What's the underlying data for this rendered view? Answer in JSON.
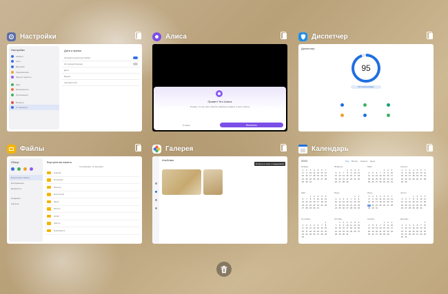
{
  "apps": {
    "settings": {
      "title": "Настройки",
      "header": "Настройки",
      "items": [
        "Аккаунт",
        "Сеть",
        "Bluetooth",
        "Уведомления",
        "Экран и яркость",
        "Звук",
        "Безопасность",
        "Приложения",
        "Батарея",
        "О планшете"
      ],
      "main_title": "Дата и время",
      "main_rows": [
        "Автоматическая настройка",
        "24-часовой формат",
        "Дата",
        "Время",
        "Часовой пояс"
      ]
    },
    "alice": {
      "title": "Алиса",
      "dialog_title": "Привет! Это Алиса",
      "dialog_text": "Я знаю, что вы часто видите знакомые экраны, и могу помочь",
      "cancel": "Отмена",
      "accept": "Включить"
    },
    "manager": {
      "title": "Диспетчер",
      "header": "Диспетчер",
      "score": "95",
      "chip": "Оптимизировано",
      "score_color": "#1f6fe0"
    },
    "files": {
      "title": "Файлы",
      "side_title": "Обзор",
      "side_items": [
        "Внутренняя память",
        "Изображения",
        "Документы",
        "Недавние",
        "Корзина"
      ],
      "main_title": "Внутренняя память",
      "sort_label": "Сортировать по времени",
      "rows": [
        "Android",
        "Download",
        "Pictures",
        "Documents",
        "Music",
        "Movies",
        "DCIM",
        "Alarms",
        "Notifications",
        "Podcasts",
        "Recordings"
      ],
      "folder_color": "#f4b400"
    },
    "gallery": {
      "title": "Галерея",
      "header": "Альбомы",
      "tooltip": "Открыть в окне с поддержкой"
    },
    "calendar": {
      "title": "Календарь",
      "year": "2024",
      "tabs": [
        "Год",
        "Месяц",
        "Неделя",
        "День"
      ],
      "months": [
        "Январь",
        "Февраль",
        "Март",
        "Апрель",
        "Май",
        "Июнь",
        "Июль",
        "Август",
        "Сентябрь",
        "Октябрь",
        "Ноябрь",
        "Декабрь"
      ],
      "accent": "#1f6fe0"
    }
  },
  "icons": {
    "settings": "gear-icon",
    "alice": "alice-icon",
    "manager": "shield-icon",
    "files": "folder-icon",
    "gallery": "flower-icon",
    "calendar": "calendar-icon",
    "split": "split-screen-icon",
    "clear": "trash-icon"
  }
}
